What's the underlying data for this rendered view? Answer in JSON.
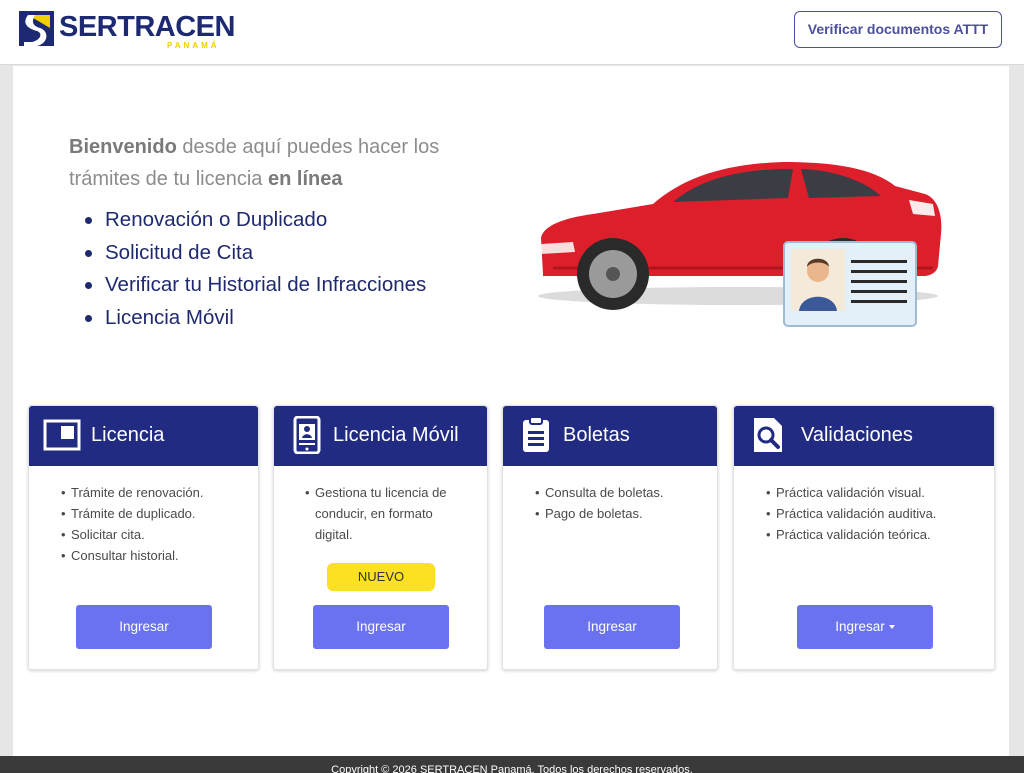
{
  "header": {
    "logo_text": "SERTRACEN",
    "logo_sub": "PANAMÁ",
    "verify_button": "Verificar documentos ATTT"
  },
  "intro": {
    "strong": "Bienvenido",
    "text1": " desde aquí puedes hacer los trámites de tu licencia ",
    "strong2": "en línea",
    "features": [
      "Renovación o Duplicado",
      "Solicitud de Cita",
      "Verificar tu Historial de Infracciones",
      "Licencia Móvil"
    ]
  },
  "cards": [
    {
      "title": "Licencia",
      "icon": "license-card-icon",
      "items": [
        "Trámite de renovación.",
        "Trámite de duplicado.",
        "Solicitar cita.",
        "Consultar historial."
      ],
      "button": "Ingresar"
    },
    {
      "title": "Licencia Móvil",
      "icon": "mobile-license-icon",
      "items": [
        "Gestiona tu licencia de conducir, en formato digital."
      ],
      "badge": "NUEVO",
      "button": "Ingresar"
    },
    {
      "title": "Boletas",
      "icon": "clipboard-icon",
      "items": [
        "Consulta de boletas.",
        "Pago de boletas."
      ],
      "button": "Ingresar"
    },
    {
      "title": "Validaciones",
      "icon": "search-document-icon",
      "items": [
        "Práctica validación visual.",
        "Práctica validación auditiva.",
        "Práctica validación teórica."
      ],
      "button": "Ingresar"
    }
  ],
  "footer": {
    "text": "Copyright © 2026 SERTRACEN Panamá. Todos los derechos reservados."
  },
  "colors": {
    "primary": "#222b82",
    "button": "#6a72f0",
    "badge": "#fce022",
    "accent": "#f2cf00"
  }
}
